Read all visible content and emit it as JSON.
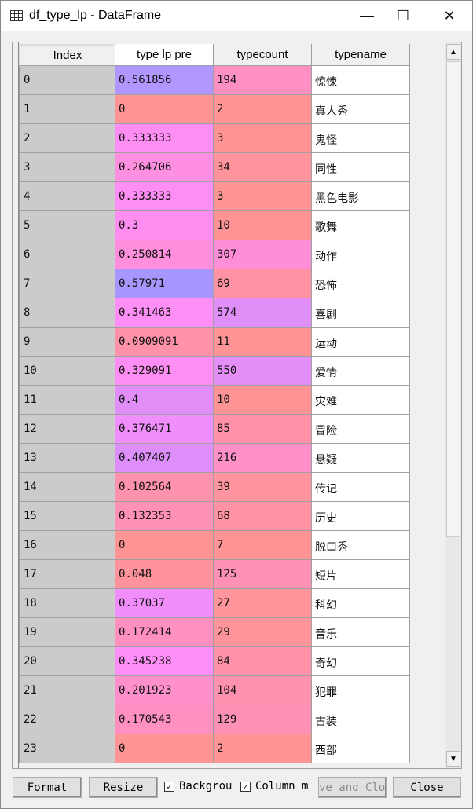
{
  "window": {
    "title": "df_type_lp - DataFrame",
    "minimize": "—",
    "maximize": "☐",
    "close": "✕"
  },
  "columns": [
    "Index",
    "type lp pre",
    "typecount",
    "typename"
  ],
  "rows": [
    {
      "index": "0",
      "pre": "0.561856",
      "count": "194",
      "name": "惊悚",
      "pre_color": "#b096ff",
      "count_color": "#ff90c4"
    },
    {
      "index": "1",
      "pre": "0",
      "count": "2",
      "name": "真人秀",
      "pre_color": "#ff9494",
      "count_color": "#ff9494"
    },
    {
      "index": "2",
      "pre": "0.333333",
      "count": "3",
      "name": "鬼怪",
      "pre_color": "#ff8ef4",
      "count_color": "#ff9494"
    },
    {
      "index": "3",
      "pre": "0.264706",
      "count": "34",
      "name": "同性",
      "pre_color": "#ff8fe0",
      "count_color": "#ff949c"
    },
    {
      "index": "4",
      "pre": "0.333333",
      "count": "3",
      "name": "黑色电影",
      "pre_color": "#ff8ef4",
      "count_color": "#ff9494"
    },
    {
      "index": "5",
      "pre": "0.3",
      "count": "10",
      "name": "歌舞",
      "pre_color": "#ff8ef0",
      "count_color": "#ff9496"
    },
    {
      "index": "6",
      "pre": "0.250814",
      "count": "307",
      "name": "动作",
      "pre_color": "#ff8fdc",
      "count_color": "#ff8ed8"
    },
    {
      "index": "7",
      "pre": "0.57971",
      "count": "69",
      "name": "恐怖",
      "pre_color": "#a896ff",
      "count_color": "#ff93a4"
    },
    {
      "index": "8",
      "pre": "0.341463",
      "count": "574",
      "name": "喜剧",
      "pre_color": "#ff8ef6",
      "count_color": "#e08ef8"
    },
    {
      "index": "9",
      "pre": "0.0909091",
      "count": "11",
      "name": "运动",
      "pre_color": "#ff92a8",
      "count_color": "#ff9496"
    },
    {
      "index": "10",
      "pre": "0.329091",
      "count": "550",
      "name": "爱情",
      "pre_color": "#ff8ef4",
      "count_color": "#e48ef8"
    },
    {
      "index": "11",
      "pre": "0.4",
      "count": "10",
      "name": "灾难",
      "pre_color": "#e28ef8",
      "count_color": "#ff9496"
    },
    {
      "index": "12",
      "pre": "0.376471",
      "count": "85",
      "name": "冒险",
      "pre_color": "#f08efc",
      "count_color": "#ff92a8"
    },
    {
      "index": "13",
      "pre": "0.407407",
      "count": "216",
      "name": "悬疑",
      "pre_color": "#de8efa",
      "count_color": "#ff90c8"
    },
    {
      "index": "14",
      "pre": "0.102564",
      "count": "39",
      "name": "传记",
      "pre_color": "#ff92ac",
      "count_color": "#ff949e"
    },
    {
      "index": "15",
      "pre": "0.132353",
      "count": "68",
      "name": "历史",
      "pre_color": "#ff91b4",
      "count_color": "#ff93a4"
    },
    {
      "index": "16",
      "pre": "0",
      "count": "7",
      "name": "脱口秀",
      "pre_color": "#ff9494",
      "count_color": "#ff9494"
    },
    {
      "index": "17",
      "pre": "0.048",
      "count": "125",
      "name": "短片",
      "pre_color": "#ff939c",
      "count_color": "#ff91b4"
    },
    {
      "index": "18",
      "pre": "0.37037",
      "count": "27",
      "name": "科幻",
      "pre_color": "#f28efc",
      "count_color": "#ff949a"
    },
    {
      "index": "19",
      "pre": "0.172414",
      "count": "29",
      "name": "音乐",
      "pre_color": "#ff90c0",
      "count_color": "#ff949a"
    },
    {
      "index": "20",
      "pre": "0.345238",
      "count": "84",
      "name": "奇幻",
      "pre_color": "#ff8ef8",
      "count_color": "#ff92a8"
    },
    {
      "index": "21",
      "pre": "0.201923",
      "count": "104",
      "name": "犯罪",
      "pre_color": "#ff90cc",
      "count_color": "#ff92ae"
    },
    {
      "index": "22",
      "pre": "0.170543",
      "count": "129",
      "name": "古装",
      "pre_color": "#ff90c0",
      "count_color": "#ff91b6"
    },
    {
      "index": "23",
      "pre": "0",
      "count": "2",
      "name": "西部",
      "pre_color": "#ff9494",
      "count_color": "#ff9494"
    }
  ],
  "footer": {
    "format": "Format",
    "resize": "Resize",
    "background": "Backgrou",
    "column_min": "Column mi",
    "save_close": "ve and Clo",
    "close": "Close",
    "check": "✓"
  }
}
